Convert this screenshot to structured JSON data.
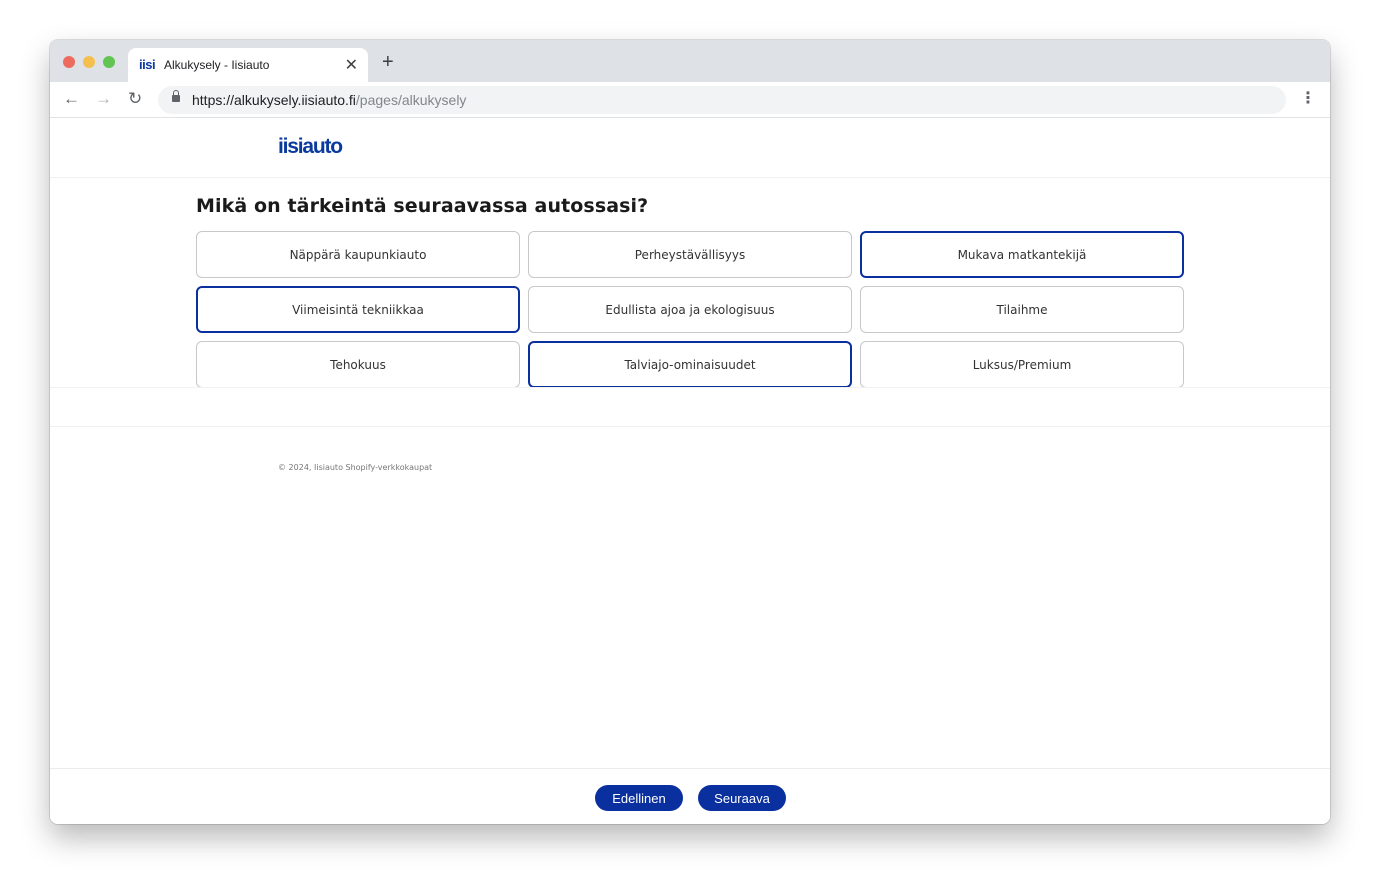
{
  "browser": {
    "tab": {
      "favicon_text": "iisi",
      "title": "Alkukysely - Iisiauto",
      "close_glyph": "✕"
    },
    "new_tab_glyph": "+",
    "nav": {
      "back_glyph": "←",
      "forward_glyph": "→",
      "reload_glyph": "↻"
    },
    "url": {
      "host": "https://alkukysely.iisiauto.fi",
      "path": "/pages/alkukysely"
    },
    "menu_glyph": "⋮"
  },
  "site": {
    "logo": "iisiauto",
    "question": "Mikä on tärkeintä seuraavassa autossasi?",
    "options": [
      {
        "label": "Näppärä kaupunkiauto",
        "selected": false
      },
      {
        "label": "Perheystävällisyys",
        "selected": false
      },
      {
        "label": "Mukava matkantekijä",
        "selected": true
      },
      {
        "label": "Viimeisintä tekniikkaa",
        "selected": true
      },
      {
        "label": "Edullista ajoa ja ekologisuus",
        "selected": false
      },
      {
        "label": "Tilaihme",
        "selected": false
      },
      {
        "label": "Tehokuus",
        "selected": false
      },
      {
        "label": "Talviajo-ominaisuudet",
        "selected": true
      },
      {
        "label": "Luksus/Premium",
        "selected": false
      }
    ],
    "copyright": "© 2024, Iisiauto Shopify-verkkokaupat",
    "buttons": {
      "previous": "Edellinen",
      "next": "Seuraava"
    }
  },
  "colors": {
    "brand": "#0a3a9e",
    "selected_border": "#0a2f9e",
    "button_bg": "#0a2f9e",
    "option_border": "#c8c8c8"
  }
}
